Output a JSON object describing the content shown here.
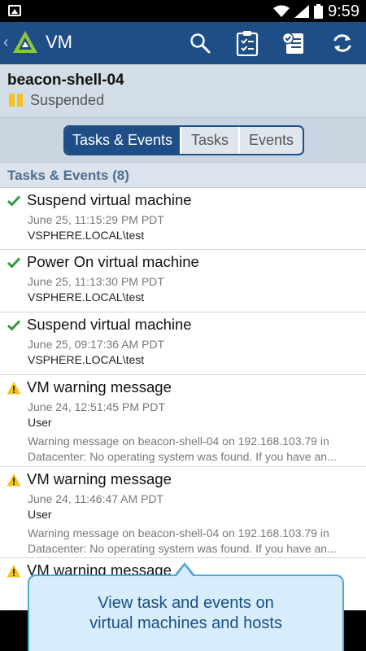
{
  "status_bar": {
    "time": "9:59"
  },
  "app_bar": {
    "title": "VM"
  },
  "vm": {
    "name": "beacon-shell-04",
    "state": "Suspended"
  },
  "tabs": [
    {
      "label": "Tasks & Events",
      "active": true
    },
    {
      "label": "Tasks",
      "active": false
    },
    {
      "label": "Events",
      "active": false
    }
  ],
  "section": {
    "title": "Tasks & Events (8)"
  },
  "items": [
    {
      "icon": "check-icon",
      "title": "Suspend virtual machine",
      "date": "June 25, 11:15:29 PM PDT",
      "user": "VSPHERE.LOCAL\\test"
    },
    {
      "icon": "check-icon",
      "title": "Power On virtual machine",
      "date": "June 25, 11:13:30 PM PDT",
      "user": "VSPHERE.LOCAL\\test"
    },
    {
      "icon": "check-icon",
      "title": "Suspend virtual machine",
      "date": "June 25, 09:17:36 AM PDT",
      "user": "VSPHERE.LOCAL\\test"
    },
    {
      "icon": "warning-icon",
      "title": "VM warning message",
      "date": "June 24, 12:51:45 PM PDT",
      "user": "User",
      "message_line1": "Warning message on beacon-shell-04 on 192.168.103.79 in",
      "message_line2": "Datacenter: No operating system was found. If you have an..."
    },
    {
      "icon": "warning-icon",
      "title": "VM warning message",
      "date": "June 24, 11:46:47 AM PDT",
      "user": "User",
      "message_line1": "Warning message on beacon-shell-04 on 192.168.103.79 in",
      "message_line2": "Datacenter: No operating system was found. If you have an..."
    },
    {
      "icon": "warning-icon",
      "title": "VM warning message"
    }
  ],
  "callout": {
    "line1": "View task and events on",
    "line2": "virtual machines and hosts"
  },
  "colors": {
    "app_bar": "#1f4e86",
    "success": "#2e9a3a",
    "warning": "#f4c21b",
    "callout_bg": "#d7edfb",
    "callout_border": "#4fa6dd"
  }
}
